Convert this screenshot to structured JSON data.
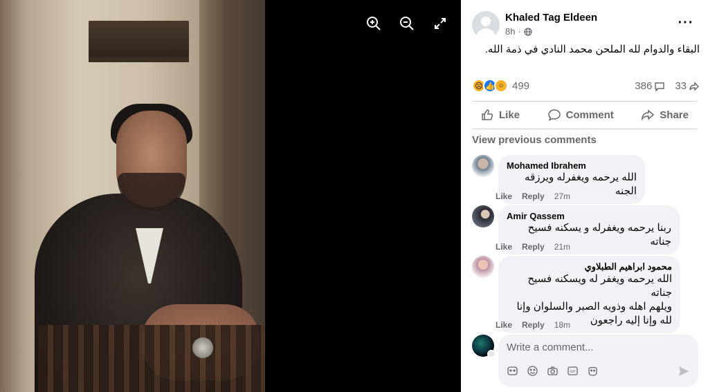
{
  "post": {
    "author": "Khaled Tag Eldeen",
    "time": "8h",
    "text": "البقاء والدوام لله الملحن محمد النادي في ذمة الله.",
    "reaction_count": "499",
    "comment_count": "386",
    "share_count": "33"
  },
  "actions": {
    "like": "Like",
    "comment": "Comment",
    "share": "Share"
  },
  "view_previous": "View previous comments",
  "comments": [
    {
      "name": "Mohamed Ibrahem",
      "text": "الله يرحمه ويغفرله ويرزقه الجنه",
      "like": "Like",
      "reply": "Reply",
      "time": "27m"
    },
    {
      "name": "Amir Qassem",
      "text": "ربنا يرحمه ويغفرله و يسكنه فسيح جناته",
      "like": "Like",
      "reply": "Reply",
      "time": "21m"
    },
    {
      "name": "محمود ابراهيم الطبلاوي",
      "text_lines": [
        "الله يرحمه ويغفر له ويسكنه فسيح جناته",
        "ويلهم اهله وذويه الصبر والسلوان وإنا",
        "لله وإنا إليه راجعون"
      ],
      "like": "Like",
      "reply": "Reply",
      "time": "18m"
    }
  ],
  "composer": {
    "placeholder": "Write a comment..."
  },
  "icons": {
    "viewer": [
      "zoom-in-icon",
      "zoom-out-icon",
      "fullscreen-icon"
    ],
    "composer": [
      "sticker-icon",
      "emoji-icon",
      "camera-icon",
      "gif-icon",
      "avatar-sticker-icon",
      "send-icon"
    ]
  },
  "colors": {
    "link_gray": "#65676b",
    "bubble": "#f0f2f5",
    "like_blue": "#1877f2"
  }
}
